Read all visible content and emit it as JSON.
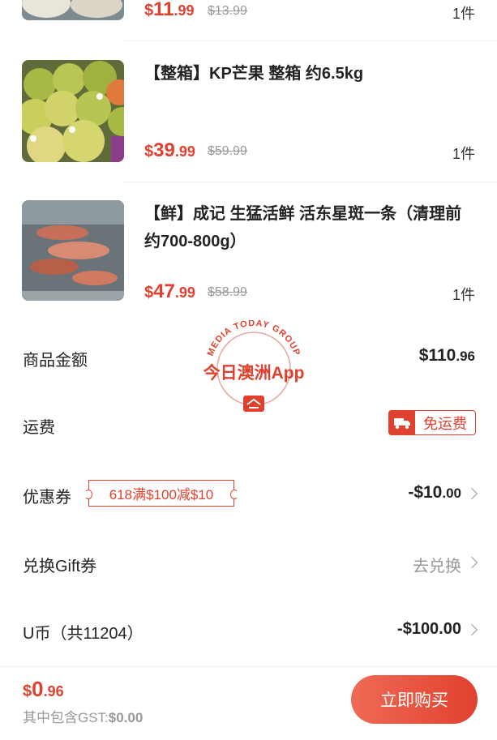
{
  "items": [
    {
      "title": "",
      "price_currency": "$",
      "price_int": "11",
      "price_dec": ".99",
      "original_price": "$13.99",
      "qty": "1件",
      "image": "partial-product-image"
    },
    {
      "title": "【整箱】KP芒果 整箱 约6.5kg",
      "price_currency": "$",
      "price_int": "39",
      "price_dec": ".99",
      "original_price": "$59.99",
      "qty": "1件",
      "image": "mango-box-photo"
    },
    {
      "title": "【鲜】成记 生猛活鲜 活东星斑一条（清理前约700-800g）",
      "price_currency": "$",
      "price_int": "47",
      "price_dec": ".99",
      "original_price": "$58.99",
      "qty": "1件",
      "image": "live-grouper-photo"
    }
  ],
  "summary": {
    "goods_label": "商品金额",
    "goods_value": "$110.96",
    "goods_value_main": "$110",
    "goods_value_dec": ".96",
    "shipping_label": "运费",
    "shipping_badge": "免运费",
    "coupon_label": "优惠券",
    "coupon_tag": "618满$100减$10",
    "coupon_value_main": "-$10",
    "coupon_value_dec": ".00",
    "gift_label": "兑换Gift券",
    "gift_value": "去兑换",
    "ucoin_label": "U币（共11204）",
    "ucoin_value": "-$100.00"
  },
  "footer": {
    "total_currency": "$",
    "total_int": "0",
    "total_dec": ".96",
    "gst_label": "其中包含GST:",
    "gst_value": "$0.00",
    "buy_label": "立即购买"
  },
  "watermark": {
    "arc_text": "MEDIA TODAY GROUP",
    "main_text": "今日澳洲App"
  },
  "colors": {
    "accent": "#e0412f",
    "muted": "#999999"
  }
}
